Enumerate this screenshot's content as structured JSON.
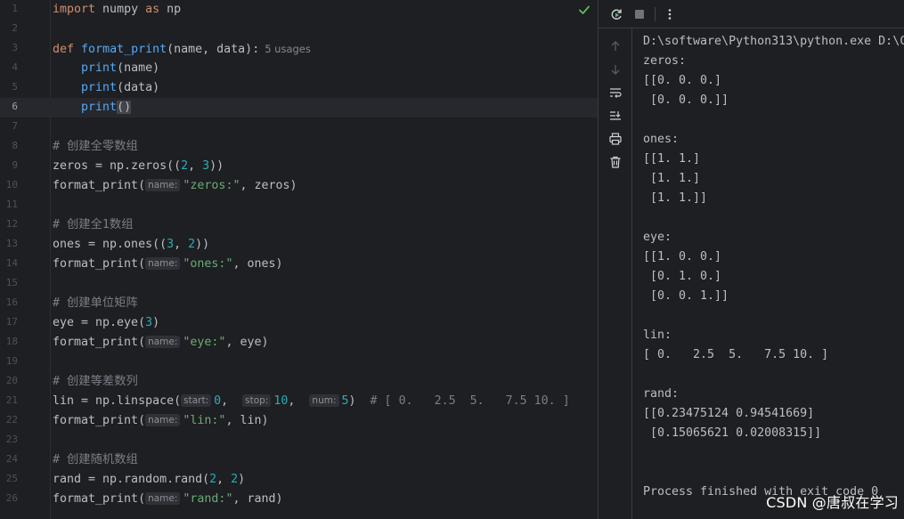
{
  "editor": {
    "lines": [
      {
        "n": "1",
        "tokens": [
          {
            "t": "import",
            "c": "kw"
          },
          {
            "t": " numpy "
          },
          {
            "t": "as",
            "c": "kw"
          },
          {
            "t": " np"
          }
        ]
      },
      {
        "n": "2",
        "tokens": []
      },
      {
        "n": "3",
        "tokens": [
          {
            "t": "def",
            "c": "kw"
          },
          {
            "t": " "
          },
          {
            "t": "format_print",
            "c": "fn"
          },
          {
            "t": "(name, data):"
          },
          {
            "t": "5 usages",
            "c": "usages"
          }
        ]
      },
      {
        "n": "4",
        "tokens": [
          {
            "t": "    "
          },
          {
            "t": "print",
            "c": "fn"
          },
          {
            "t": "(name)"
          }
        ]
      },
      {
        "n": "5",
        "tokens": [
          {
            "t": "    "
          },
          {
            "t": "print",
            "c": "fn"
          },
          {
            "t": "(data)"
          }
        ]
      },
      {
        "n": "6",
        "current": true,
        "tokens": [
          {
            "t": "    "
          },
          {
            "t": "print",
            "c": "fn"
          },
          {
            "t": "()",
            "c": "paren-hl"
          }
        ]
      },
      {
        "n": "7",
        "tokens": []
      },
      {
        "n": "8",
        "tokens": [
          {
            "t": "# 创建全零数组",
            "c": "cmt"
          }
        ]
      },
      {
        "n": "9",
        "tokens": [
          {
            "t": "zeros = np.zeros(("
          },
          {
            "t": "2",
            "c": "num"
          },
          {
            "t": ", "
          },
          {
            "t": "3",
            "c": "num"
          },
          {
            "t": "))"
          }
        ]
      },
      {
        "n": "10",
        "tokens": [
          {
            "t": "format_print("
          },
          {
            "t": "name:",
            "c": "hint"
          },
          {
            "t": "\"zeros:\"",
            "c": "str"
          },
          {
            "t": ", zeros)"
          }
        ]
      },
      {
        "n": "11",
        "tokens": []
      },
      {
        "n": "12",
        "tokens": [
          {
            "t": "# 创建全1数组",
            "c": "cmt"
          }
        ]
      },
      {
        "n": "13",
        "tokens": [
          {
            "t": "ones = np.ones(("
          },
          {
            "t": "3",
            "c": "num"
          },
          {
            "t": ", "
          },
          {
            "t": "2",
            "c": "num"
          },
          {
            "t": "))"
          }
        ]
      },
      {
        "n": "14",
        "tokens": [
          {
            "t": "format_print("
          },
          {
            "t": "name:",
            "c": "hint"
          },
          {
            "t": "\"ones:\"",
            "c": "str"
          },
          {
            "t": ", ones)"
          }
        ]
      },
      {
        "n": "15",
        "tokens": []
      },
      {
        "n": "16",
        "tokens": [
          {
            "t": "# 创建单位矩阵",
            "c": "cmt"
          }
        ]
      },
      {
        "n": "17",
        "tokens": [
          {
            "t": "eye = np.eye("
          },
          {
            "t": "3",
            "c": "num"
          },
          {
            "t": ")"
          }
        ]
      },
      {
        "n": "18",
        "tokens": [
          {
            "t": "format_print("
          },
          {
            "t": "name:",
            "c": "hint"
          },
          {
            "t": "\"eye:\"",
            "c": "str"
          },
          {
            "t": ", eye)"
          }
        ]
      },
      {
        "n": "19",
        "tokens": []
      },
      {
        "n": "20",
        "tokens": [
          {
            "t": "# 创建等差数列",
            "c": "cmt"
          }
        ]
      },
      {
        "n": "21",
        "tokens": [
          {
            "t": "lin = np.linspace("
          },
          {
            "t": "start:",
            "c": "hint"
          },
          {
            "t": "0",
            "c": "num"
          },
          {
            "t": ",  "
          },
          {
            "t": "stop:",
            "c": "hint"
          },
          {
            "t": "10",
            "c": "num"
          },
          {
            "t": ",  "
          },
          {
            "t": "num:",
            "c": "hint"
          },
          {
            "t": "5",
            "c": "num"
          },
          {
            "t": ")  "
          },
          {
            "t": "# [ 0.   2.5  5.   7.5 10. ]",
            "c": "cmt"
          }
        ]
      },
      {
        "n": "22",
        "tokens": [
          {
            "t": "format_print("
          },
          {
            "t": "name:",
            "c": "hint"
          },
          {
            "t": "\"lin:\"",
            "c": "str"
          },
          {
            "t": ", lin)"
          }
        ]
      },
      {
        "n": "23",
        "tokens": []
      },
      {
        "n": "24",
        "tokens": [
          {
            "t": "# 创建随机数组",
            "c": "cmt"
          }
        ]
      },
      {
        "n": "25",
        "tokens": [
          {
            "t": "rand = np.random.rand("
          },
          {
            "t": "2",
            "c": "num"
          },
          {
            "t": ", "
          },
          {
            "t": "2",
            "c": "num"
          },
          {
            "t": ")"
          }
        ]
      },
      {
        "n": "26",
        "tokens": [
          {
            "t": "format_print("
          },
          {
            "t": "name:",
            "c": "hint"
          },
          {
            "t": "\"rand:\"",
            "c": "str"
          },
          {
            "t": ", rand)"
          }
        ]
      }
    ]
  },
  "console": {
    "lines": [
      "D:\\software\\Python313\\python.exe D:\\C",
      "zeros:",
      "[[0. 0. 0.]",
      " [0. 0. 0.]]",
      "",
      "ones:",
      "[[1. 1.]",
      " [1. 1.]",
      " [1. 1.]]",
      "",
      "eye:",
      "[[1. 0. 0.]",
      " [0. 1. 0.]",
      " [0. 0. 1.]]",
      "",
      "lin:",
      "[ 0.   2.5  5.   7.5 10. ]",
      "",
      "rand:",
      "[[0.23475124 0.94541669]",
      " [0.15065621 0.02008315]]",
      "",
      "",
      "Process finished with exit code 0"
    ]
  },
  "toolbar": {
    "rerun_icon": "rerun-icon",
    "stop_icon": "stop-icon",
    "more_icon": "more-options-icon"
  },
  "side_toolbar": [
    "arrow-up-icon",
    "arrow-down-icon",
    "soft-wrap-icon",
    "scroll-to-end-icon",
    "print-icon",
    "trash-icon"
  ],
  "watermark": "CSDN @唐叔在学习",
  "colors": {
    "background": "#1e1f22",
    "keyword": "#cf8e6d",
    "function": "#56a8f5",
    "number": "#2aacb8",
    "string": "#6aab73",
    "comment": "#7a7e85",
    "check": "#5fb865"
  }
}
